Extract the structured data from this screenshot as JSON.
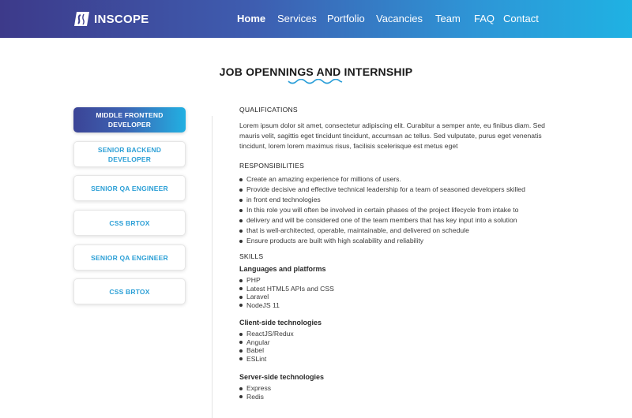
{
  "header": {
    "logo_text": "INSCOPE",
    "nav": [
      "Home",
      "Services",
      "Portfolio",
      "Vacancies",
      "Team",
      "FAQ",
      "Contact"
    ],
    "active_nav": "Home"
  },
  "page": {
    "title": "JOB OPENNINGS AND INTERNSHIP"
  },
  "jobs": [
    {
      "label": "MIDDLE FRONTEND DEVELOPER",
      "line1": "MIDDLE FRONTEND",
      "line2": "DEVELOPER",
      "active": true
    },
    {
      "label": "SENIOR BACKEND DEVELOPER",
      "line1": "SENIOR BACKEND",
      "line2": "DEVELOPER",
      "active": false
    },
    {
      "label": "SENIOR QA ENGINEER",
      "line1": "SENIOR QA ENGINEER",
      "line2": "",
      "active": false
    },
    {
      "label": "CSS BRTOX",
      "line1": "CSS BRTOX",
      "line2": "",
      "active": false
    },
    {
      "label": "SENIOR QA ENGINEER",
      "line1": "SENIOR QA ENGINEER",
      "line2": "",
      "active": false
    },
    {
      "label": "CSS BRTOX",
      "line1": "CSS BRTOX",
      "line2": "",
      "active": false
    }
  ],
  "details": {
    "qualifications_title": "QUALIFICATIONS",
    "qualifications_text": "Lorem ipsum dolor sit amet, consectetur adipiscing elit. Curabitur a semper ante, eu finibus diam. Sed mauris velit, sagittis eget tincidunt tincidunt, accumsan ac tellus. Sed vulputate, purus eget venenatis tincidunt, lorem lorem maximus risus, facilisis scelerisque est metus eget",
    "responsibilities_title": "RESPONSIBILITIES",
    "responsibilities": [
      "Create an amazing experience for millions of users.",
      "Provide decisive and effective technical leadership for a team of seasoned developers skilled",
      "in front end technologies",
      "In this role you will often be involved in certain phases of the project lifecycle from intake to",
      "delivery and will be considered one of the team members that has key input into a solution",
      "that is well-architected, operable, maintainable, and delivered on schedule",
      "Ensure products are built with high scalability and reliability"
    ],
    "skills_title": "SKILLS",
    "skill_groups": [
      {
        "title": "Languages and platforms",
        "items": [
          "PHP",
          "Latest HTML5 APIs and CSS",
          "Laravel",
          "NodeJS 11"
        ]
      },
      {
        "title": "Client-side technologies",
        "items": [
          "ReactJS/Redux",
          "Angular",
          "Babel",
          "ESLint"
        ]
      },
      {
        "title": "Server-side technologies",
        "items": [
          "Express",
          "Redis"
        ]
      }
    ]
  },
  "colors": {
    "header_gradient_start": "#3d3a8a",
    "header_gradient_end": "#1fb2e3",
    "accent": "#2b9fd6"
  }
}
